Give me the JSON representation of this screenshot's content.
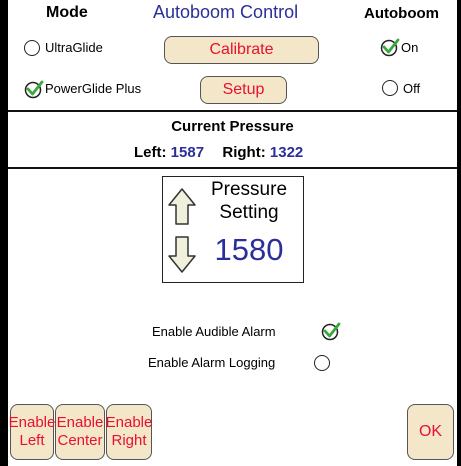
{
  "header": {
    "mode_label": "Mode",
    "title": "Autoboom Control",
    "autoboom_label": "Autoboom"
  },
  "mode_options": [
    {
      "label": "UltraGlide",
      "selected": false
    },
    {
      "label": "PowerGlide Plus",
      "selected": true
    }
  ],
  "buttons": {
    "calibrate": "Calibrate",
    "setup": "Setup",
    "enable_left_line1": "Enable",
    "enable_left_line2": "Left",
    "enable_center_line1": "Enable",
    "enable_center_line2": "Center",
    "enable_right_line1": "Enable",
    "enable_right_line2": "Right",
    "ok": "OK"
  },
  "autoboom_options": [
    {
      "label": "On",
      "selected": true
    },
    {
      "label": "Off",
      "selected": false
    }
  ],
  "current_pressure": {
    "heading": "Current Pressure",
    "left_label": "Left:",
    "left_value": "1587",
    "right_label": "Right:",
    "right_value": "1322"
  },
  "pressure_setting": {
    "line1": "Pressure",
    "line2": "Setting",
    "value": "1580"
  },
  "alarms": {
    "audible_label": "Enable Audible Alarm",
    "audible_checked": true,
    "logging_label": "Enable Alarm Logging",
    "logging_checked": false
  },
  "colors": {
    "accent_blue": "#2a2f9a",
    "button_text_red": "#e8102e",
    "button_fill": "#f4e7c9",
    "check_green": "#3aa83a"
  },
  "icons": [
    "radio-icon",
    "check-icon",
    "arrow-up-icon",
    "arrow-down-icon"
  ]
}
